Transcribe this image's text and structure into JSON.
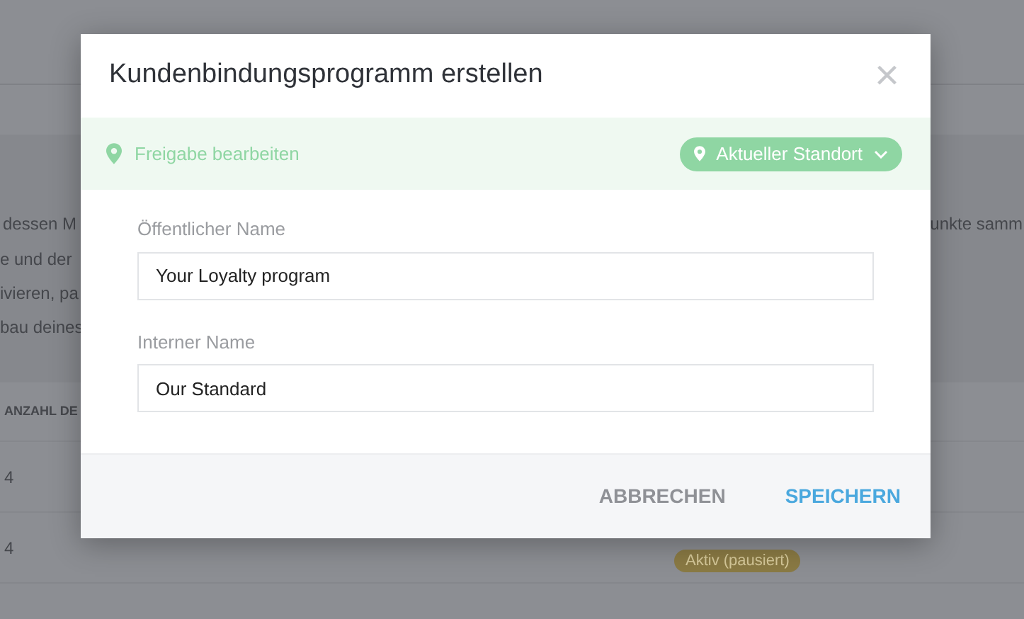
{
  "background": {
    "text_left": [
      "dessen M",
      "e und der",
      "ivieren, pa",
      "bau deines"
    ],
    "text_right": "unkte samm",
    "table_header": "ANZAHL DE",
    "rows": [
      {
        "count": "4"
      },
      {
        "count": "4",
        "status": "Aktiv (pausiert)"
      }
    ]
  },
  "dialog": {
    "title": "Kundenbindungsprogramm erstellen",
    "close": "×",
    "share": {
      "label": "Freigabe bearbeiten",
      "location": "Aktueller Standort"
    },
    "fields": [
      {
        "label": "Öffentlicher Name",
        "value": "Your Loyalty program"
      },
      {
        "label": "Interner Name",
        "value": "Our Standard"
      }
    ],
    "buttons": [
      {
        "label": "ABBRECHEN",
        "kind": "cancel"
      },
      {
        "label": "SPEICHERN",
        "kind": "primary"
      }
    ]
  }
}
